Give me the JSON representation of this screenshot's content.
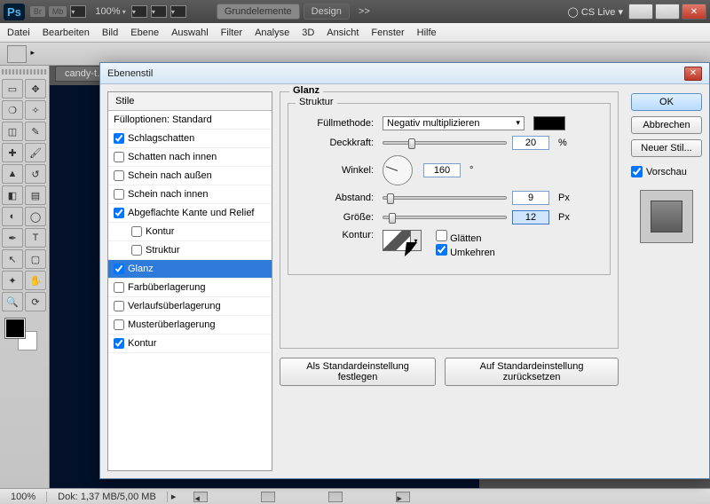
{
  "app": {
    "zoom_header": "100%",
    "panel_a": "Grundelemente",
    "panel_b": "Design",
    "chev": ">>",
    "cslive": "CS Live ▾"
  },
  "menu": [
    "Datei",
    "Bearbeiten",
    "Bild",
    "Ebene",
    "Auswahl",
    "Filter",
    "Analyse",
    "3D",
    "Ansicht",
    "Fenster",
    "Hilfe"
  ],
  "tab": "candy-t...",
  "status": {
    "zoom": "100%",
    "doc": "Dok: 1,37 MB/5,00 MB"
  },
  "dialog": {
    "title": "Ebenenstil",
    "list_header": "Stile",
    "blend_opts": "Füll­optionen: Standard",
    "items": [
      {
        "label": "Schlagschatten",
        "checked": true,
        "indent": false
      },
      {
        "label": "Schatten nach innen",
        "checked": false,
        "indent": false
      },
      {
        "label": "Schein nach außen",
        "checked": false,
        "indent": false
      },
      {
        "label": "Schein nach innen",
        "checked": false,
        "indent": false
      },
      {
        "label": "Abgeflachte Kante und Relief",
        "checked": true,
        "indent": false
      },
      {
        "label": "Kontur",
        "checked": false,
        "indent": true
      },
      {
        "label": "Struktur",
        "checked": false,
        "indent": true
      },
      {
        "label": "Glanz",
        "checked": true,
        "indent": false,
        "selected": true
      },
      {
        "label": "Farbüberlagerung",
        "checked": false,
        "indent": false
      },
      {
        "label": "Verlaufsüberlagerung",
        "checked": false,
        "indent": false
      },
      {
        "label": "Musterüberlagerung",
        "checked": false,
        "indent": false
      },
      {
        "label": "Kontur",
        "checked": true,
        "indent": false
      }
    ],
    "panel_title": "Glanz",
    "struct_title": "Struktur",
    "fill_label": "Füllmethode:",
    "fill_value": "Negativ multiplizieren",
    "opacity_label": "Deckkraft:",
    "opacity_value": "20",
    "opacity_unit": "%",
    "angle_label": "Winkel:",
    "angle_value": "160",
    "angle_unit": "°",
    "dist_label": "Abstand:",
    "dist_value": "9",
    "dist_unit": "Px",
    "size_label": "Größe:",
    "size_value": "12",
    "size_unit": "Px",
    "contour_label": "Kontur:",
    "antialias": "Glätten",
    "invert": "Umkehren",
    "btn_default": "Als Standardeinstellung festlegen",
    "btn_reset": "Auf Standardeinstellung zurücksetzen",
    "ok": "OK",
    "cancel": "Abbrechen",
    "newstyle": "Neuer Stil...",
    "preview_label": "Vorschau"
  }
}
